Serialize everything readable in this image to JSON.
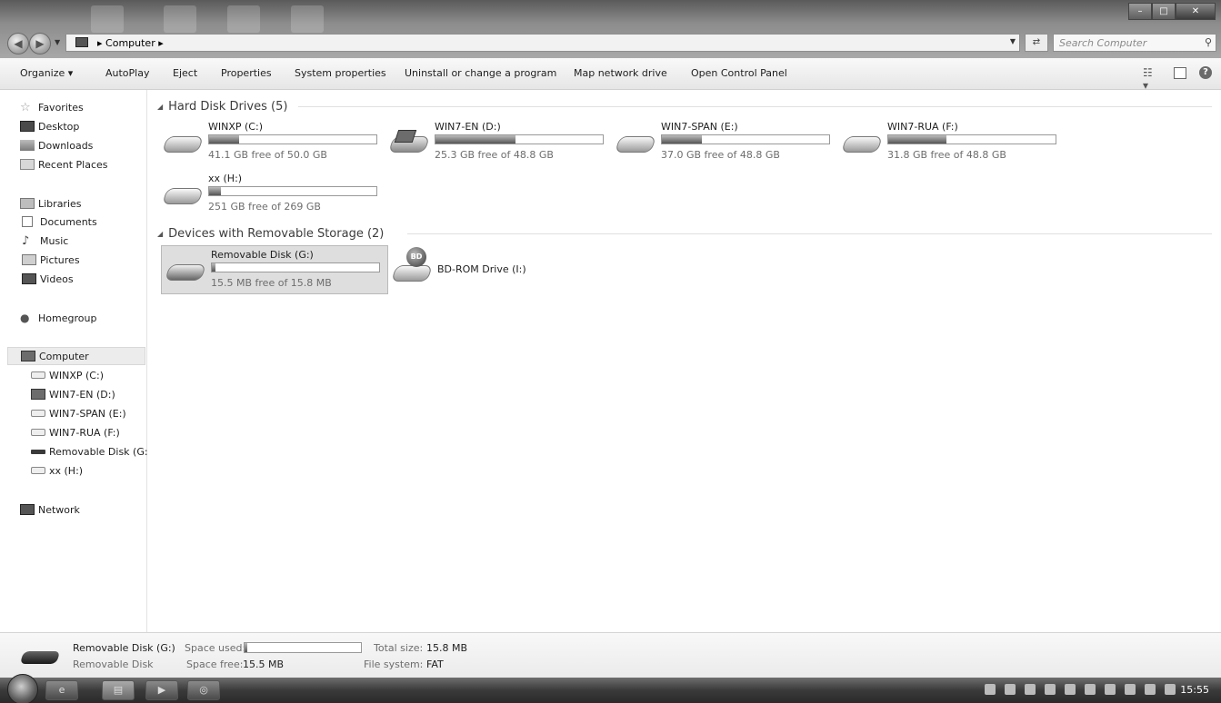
{
  "window": {
    "breadcrumb": [
      "Computer"
    ],
    "search_placeholder": "Search Computer"
  },
  "toolbar": {
    "organize": "Organize ▾",
    "autoplay": "AutoPlay",
    "eject": "Eject",
    "properties": "Properties",
    "system_properties": "System properties",
    "uninstall": "Uninstall or change a program",
    "map_drive": "Map network drive",
    "control_panel": "Open Control Panel"
  },
  "sidebar": {
    "favorites": "Favorites",
    "desktop": "Desktop",
    "downloads": "Downloads",
    "recent": "Recent Places",
    "libraries": "Libraries",
    "documents": "Documents",
    "music": "Music",
    "pictures": "Pictures",
    "videos": "Videos",
    "homegroup": "Homegroup",
    "computer": "Computer",
    "computer_items": [
      "WINXP (C:)",
      "WIN7-EN (D:)",
      "WIN7-SPAN (E:)",
      "WIN7-RUA (F:)",
      "Removable Disk (G:)",
      "xx (H:)"
    ],
    "network": "Network"
  },
  "groups": {
    "hdd": "Hard Disk Drives (5)",
    "removable": "Devices with Removable Storage (2)"
  },
  "drives": {
    "c": {
      "name": "WINXP (C:)",
      "free": "41.1 GB free of 50.0 GB",
      "used_fraction": 0.18
    },
    "d": {
      "name": "WIN7-EN (D:)",
      "free": "25.3 GB free of 48.8 GB",
      "used_fraction": 0.48
    },
    "e": {
      "name": "WIN7-SPAN (E:)",
      "free": "37.0 GB free of 48.8 GB",
      "used_fraction": 0.24
    },
    "f": {
      "name": "WIN7-RUA (F:)",
      "free": "31.8 GB free of 48.8 GB",
      "used_fraction": 0.35
    },
    "h": {
      "name": "xx (H:)",
      "free": "251 GB free of 269 GB",
      "used_fraction": 0.07
    },
    "g": {
      "name": "Removable Disk (G:)",
      "free": "15.5 MB free of 15.8 MB",
      "used_fraction": 0.02
    },
    "i": {
      "name": "BD-ROM Drive (I:)",
      "badge": "BD"
    }
  },
  "details": {
    "name": "Removable Disk (G:)",
    "type": "Removable Disk",
    "space_used_label": "Space used:",
    "space_used_fraction": 0.02,
    "space_free_label": "Space free:",
    "space_free": "15.5 MB",
    "total_size_label": "Total size:",
    "total_size": "15.8 MB",
    "file_system_label": "File system:",
    "file_system": "FAT"
  },
  "taskbar": {
    "clock": "15:55"
  }
}
